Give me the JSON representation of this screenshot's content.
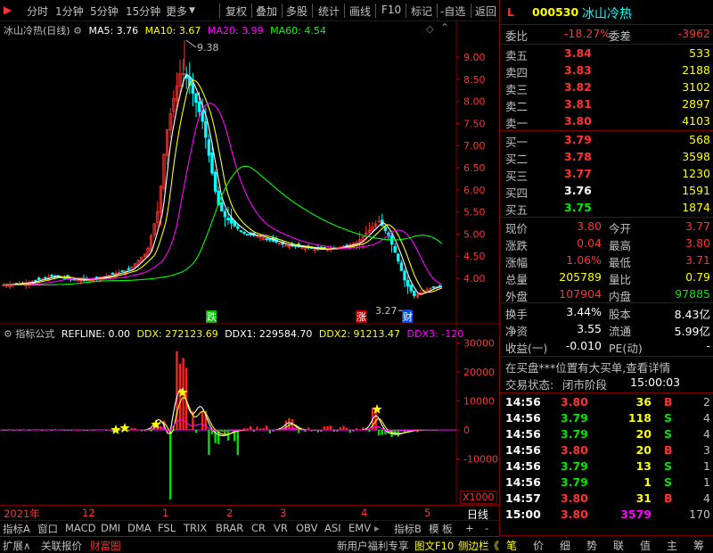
{
  "toolbar": {
    "periods": [
      "分时",
      "1分钟",
      "5分钟",
      "15分钟",
      "更多"
    ],
    "actions": [
      "复权",
      "叠加",
      "多股",
      "统计",
      "画线",
      "F10",
      "标记",
      "-自选",
      "返回"
    ]
  },
  "stock": {
    "code": "000530",
    "name": "冰山冷热",
    "flag": "L"
  },
  "kchart": {
    "title": "冰山冷热(日线)",
    "ma": [
      {
        "label": "MA5: 3.76",
        "color": "#ffffff"
      },
      {
        "label": "MA10: 3.67",
        "color": "#ffff00"
      },
      {
        "label": "MA20: 3.99",
        "color": "#ff00ff"
      },
      {
        "label": "MA60: 4.54",
        "color": "#00ff00"
      }
    ],
    "yticks": [
      "9.00",
      "8.50",
      "8.00",
      "7.50",
      "7.00",
      "6.50",
      "6.00",
      "5.50",
      "5.00",
      "4.50",
      "4.00"
    ],
    "high_label": "9.38",
    "low_label": "3.27",
    "events": [
      {
        "t": "跌",
        "color": "#00c000"
      },
      {
        "t": "涨",
        "color": "#c00000"
      },
      {
        "t": "财",
        "color": "#0050ff"
      }
    ]
  },
  "ichart": {
    "name": "指标公式",
    "values": [
      {
        "label": "REFLINE: 0.00",
        "color": "#ffffff"
      },
      {
        "label": "DDX: 272123.69",
        "color": "#ffff00"
      },
      {
        "label": "DDX1: 229584.70",
        "color": "#ffffff"
      },
      {
        "label": "DDX2: 91213.47",
        "color": "#ffff00"
      },
      {
        "label": "DDX3: -120",
        "color": "#ff00ff"
      }
    ],
    "yticks": [
      "30000",
      "20000",
      "10000",
      "0",
      "-10000"
    ],
    "unit": "X1000"
  },
  "timeaxis": {
    "labels": [
      "2021年",
      "12",
      "1",
      "2",
      "3",
      "4",
      "5"
    ],
    "mode": "日线"
  },
  "tabs1": [
    "指标A",
    "窗口",
    "MACD",
    "DMI",
    "DMA",
    "FSL",
    "TRIX",
    "BRAR",
    "CR",
    "VR",
    "OBV",
    "ASI",
    "EMV",
    "指标B",
    "模 板",
    "+",
    "-"
  ],
  "tabs2": {
    "left": [
      "扩展∧",
      "关联报价",
      "财富圈"
    ],
    "right": [
      "新用户福利专享",
      "图文F10",
      "侧边栏《"
    ]
  },
  "quote": {
    "weibi_label": "委比",
    "weibi": "-18.27%",
    "weicha_label": "委差",
    "weicha": "-3962",
    "sell": [
      {
        "l": "卖五",
        "p": "3.84",
        "v": "533"
      },
      {
        "l": "卖四",
        "p": "3.83",
        "v": "2188"
      },
      {
        "l": "卖三",
        "p": "3.82",
        "v": "3102"
      },
      {
        "l": "卖二",
        "p": "3.81",
        "v": "2897"
      },
      {
        "l": "卖一",
        "p": "3.80",
        "v": "4103"
      }
    ],
    "buy": [
      {
        "l": "买一",
        "p": "3.79",
        "v": "568"
      },
      {
        "l": "买二",
        "p": "3.78",
        "v": "3598"
      },
      {
        "l": "买三",
        "p": "3.77",
        "v": "1230"
      },
      {
        "l": "买四",
        "p": "3.76",
        "v": "1591"
      },
      {
        "l": "买五",
        "p": "3.75",
        "v": "1874"
      }
    ],
    "stats": [
      {
        "a": "现价",
        "av": "3.80",
        "b": "今开",
        "bv": "3.77"
      },
      {
        "a": "涨跌",
        "av": "0.04",
        "b": "最高",
        "bv": "3.80"
      },
      {
        "a": "涨幅",
        "av": "1.06%",
        "b": "最低",
        "bv": "3.71"
      },
      {
        "a": "总量",
        "av": "205789",
        "b": "量比",
        "bv": "0.79"
      },
      {
        "a": "外盘",
        "av": "107904",
        "b": "内盘",
        "bv": "97885"
      }
    ],
    "fin": [
      {
        "a": "换手",
        "av": "3.44%",
        "b": "股本",
        "bv": "8.43亿"
      },
      {
        "a": "净资",
        "av": "3.55",
        "b": "流通",
        "bv": "5.99亿"
      },
      {
        "a": "收益(一)",
        "av": "-0.010",
        "b": "PE(动)",
        "bv": "-"
      }
    ],
    "notice": "在买盘***位置有大买单,查看详情",
    "status_label": "交易状态:",
    "status": "闭市阶段",
    "status_time": "15:00:03",
    "ticks": [
      {
        "t": "14:56",
        "p": "3.80",
        "v": "36",
        "s": "B",
        "n": "2"
      },
      {
        "t": "14:56",
        "p": "3.79",
        "v": "118",
        "s": "S",
        "n": "4"
      },
      {
        "t": "14:56",
        "p": "3.79",
        "v": "20",
        "s": "S",
        "n": "4"
      },
      {
        "t": "14:56",
        "p": "3.80",
        "v": "20",
        "s": "B",
        "n": "3"
      },
      {
        "t": "14:56",
        "p": "3.79",
        "v": "13",
        "s": "S",
        "n": "1"
      },
      {
        "t": "14:56",
        "p": "3.79",
        "v": "1",
        "s": "S",
        "n": "1"
      },
      {
        "t": "14:57",
        "p": "3.80",
        "v": "31",
        "s": "B",
        "n": "4"
      },
      {
        "t": "15:00",
        "p": "3.80",
        "v": "3579",
        "s": "",
        "n": "170"
      }
    ]
  },
  "rtabs": [
    "笔",
    "价",
    "细",
    "势",
    "联",
    "值",
    "主",
    "筹"
  ]
}
